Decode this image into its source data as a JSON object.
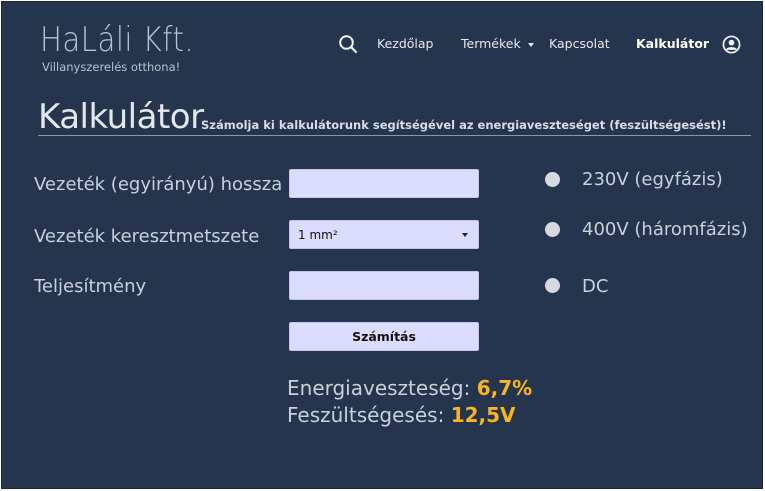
{
  "header": {
    "logo": "HaLáli Kft.",
    "tagline": "Villanyszerelés otthona!",
    "nav": {
      "home": "Kezdőlap",
      "products": "Termékek",
      "contact": "Kapcsolat",
      "calculator": "Kalkulátor"
    }
  },
  "page": {
    "title": "Kalkulátor",
    "subtitle": "Számolja ki kalkulátorunk segítségével az energiaveszteséget (feszültségesést)!"
  },
  "form": {
    "length_label": "Vezeték (egyirányú) hossza",
    "length_value": "",
    "cross_section_label": "Vezeték keresztmetszete",
    "cross_section_selected": "1 mm²",
    "power_label": "Teljesítmény",
    "power_value": "",
    "submit_label": "Számítás"
  },
  "voltage_options": [
    {
      "label": "230V (egyfázis)",
      "selected": false
    },
    {
      "label": "400V (háromfázis)",
      "selected": false
    },
    {
      "label": "DC",
      "selected": false
    }
  ],
  "results": {
    "loss_label": "Energiaveszteség:",
    "loss_value": "6,7%",
    "drop_label": "Feszültségesés:",
    "drop_value": "12,5V"
  },
  "colors": {
    "background": "#25354d",
    "field": "#dcdcff",
    "accent": "#f7b524"
  }
}
